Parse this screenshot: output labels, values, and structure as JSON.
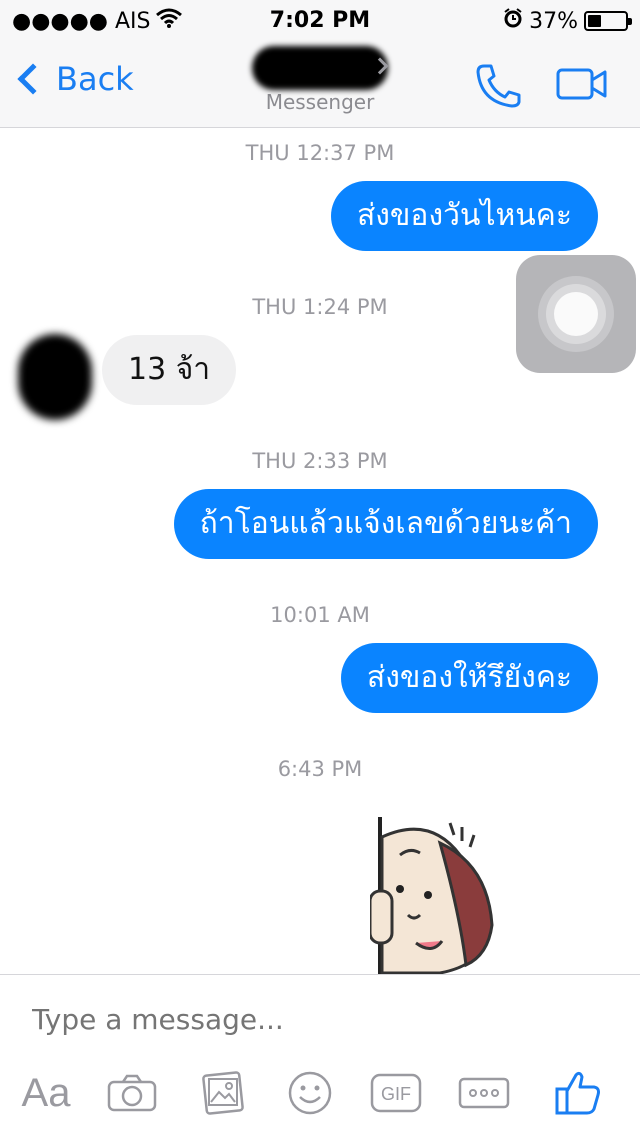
{
  "status_bar": {
    "carrier": "●●●●● AIS",
    "time": "7:02 PM",
    "battery_percent": "37%",
    "battery_level": 0.37
  },
  "nav": {
    "back_label": "Back",
    "subtitle": "Messenger"
  },
  "messages": [
    {
      "type": "timestamp",
      "text": "THU 12:37 PM"
    },
    {
      "type": "outgoing",
      "text": "ส่งของวันไหนคะ"
    },
    {
      "type": "timestamp",
      "text": "THU 1:24 PM"
    },
    {
      "type": "incoming",
      "text": "13 จ้า"
    },
    {
      "type": "timestamp",
      "text": "THU 2:33 PM"
    },
    {
      "type": "outgoing",
      "text": "ถ้าโอนแล้วแจ้งเลขด้วยนะค้า"
    },
    {
      "type": "timestamp",
      "text": "10:01 AM"
    },
    {
      "type": "outgoing",
      "text": "ส่งของให้รึยังคะ"
    },
    {
      "type": "timestamp",
      "text": "6:43 PM"
    }
  ],
  "composer": {
    "placeholder": "Type a message...",
    "aa_label": "Aa",
    "gif_label": "GIF"
  },
  "colors": {
    "accent": "#0a84ff",
    "nav_blue": "#1a7ef2",
    "incoming_bubble": "#f0f0f1",
    "timestamp": "#9a9aa0"
  }
}
